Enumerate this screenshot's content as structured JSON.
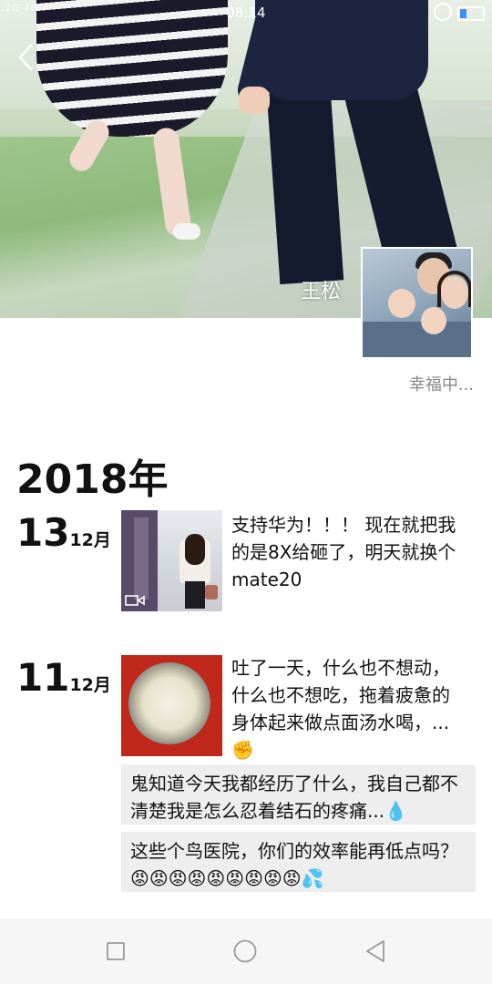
{
  "status_bar": {
    "time": "08:14",
    "signal_text": "2G 4G",
    "battery_level": 0.25,
    "accent": "#3a8cff"
  },
  "profile": {
    "name": "王松",
    "signature": "幸福中..."
  },
  "timeline": {
    "year": "2018年",
    "entries": [
      {
        "day": "13",
        "month": "12月",
        "text": "支持华为！！！ 现在就把我的是8X给砸了，明天就换个mate20",
        "media": "video-thumbnail"
      },
      {
        "day": "11",
        "month": "12月",
        "text": "吐了一天，什么也不想动，什么也不想吃，拖着疲惫的身体起来做点面汤水喝，...✊",
        "media": "photo-thumbnail"
      }
    ],
    "text_posts": [
      {
        "text": "鬼知道今天我都经历了什么，我自己都不清楚我是怎么忍着结石的疼痛...💧"
      },
      {
        "text": "这些个鸟医院，你们的效率能再低点吗？ 😡😡😡😡😡😡😡😡😡💦"
      }
    ]
  },
  "nav_bar": {
    "icons": [
      "recent-apps-icon",
      "home-icon",
      "back-icon"
    ]
  }
}
